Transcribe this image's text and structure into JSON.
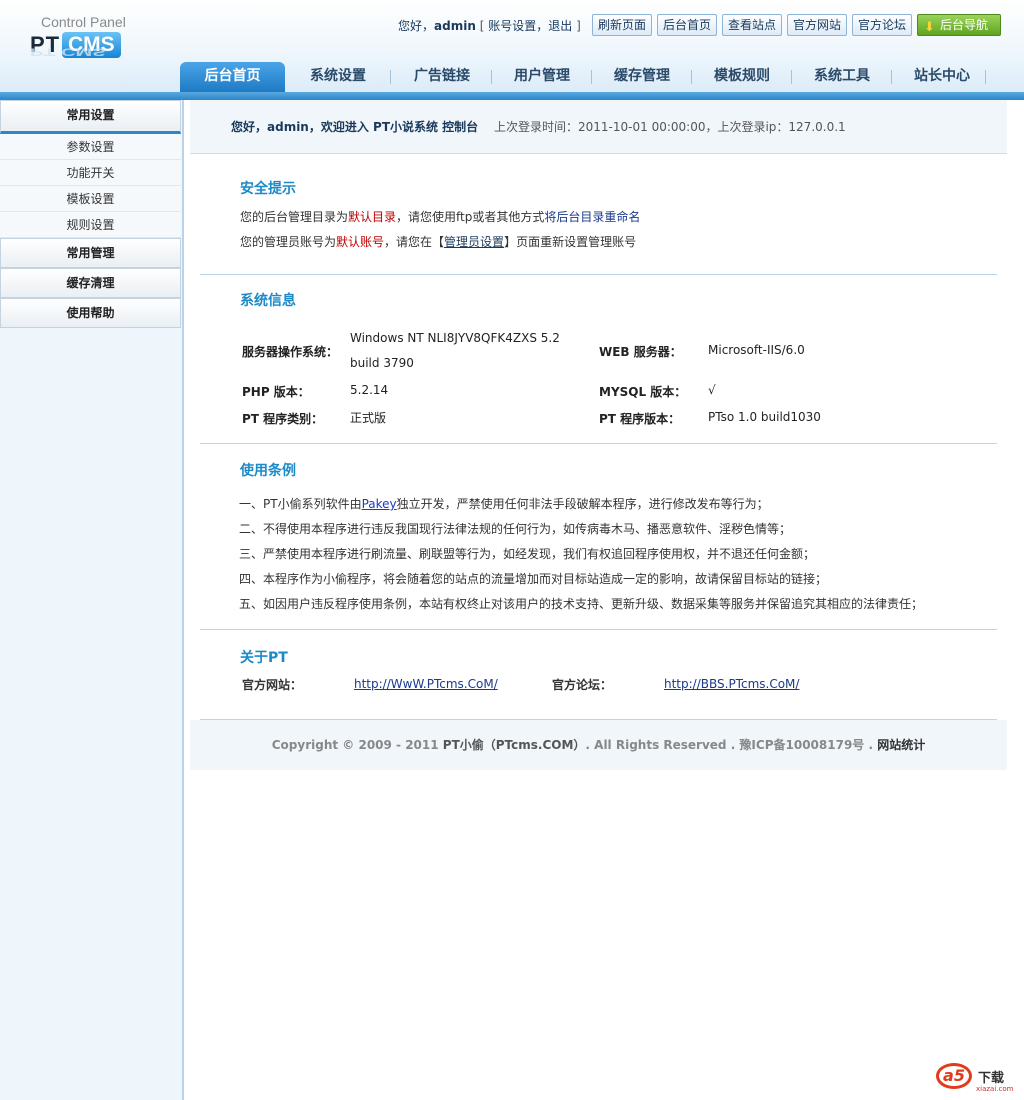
{
  "header": {
    "logo_top": "Control Panel",
    "logo_pt": "PT",
    "logo_cms": "CMS",
    "greeting": "您好，",
    "username": "admin",
    "bracket_open": "[",
    "account_settings": "账号设置",
    "comma": "，",
    "logout": "退出",
    "bracket_close": "]",
    "buttons": [
      "刷新页面",
      "后台首页",
      "查看站点",
      "官方网站",
      "官方论坛",
      "后台导航"
    ],
    "nav": [
      "后台首页",
      "系统设置",
      "广告链接",
      "用户管理",
      "缓存管理",
      "模板规则",
      "系统工具",
      "站长中心"
    ],
    "active_nav": "后台首页",
    "accent": "#1e7ac4"
  },
  "sidebar": {
    "sections": [
      {
        "title": "常用设置",
        "items": [
          "参数设置",
          "功能开关",
          "模板设置",
          "规则设置"
        ]
      },
      {
        "title": "常用管理",
        "items": []
      },
      {
        "title": "缓存清理",
        "items": []
      },
      {
        "title": "使用帮助",
        "items": []
      }
    ]
  },
  "welcome": {
    "text": "您好，admin，欢迎进入 PT小说系统 控制台",
    "lastlogin": "上次登录时间：2011-10-01 00:00:00，上次登录ip：127.0.0.1"
  },
  "security": {
    "title": "安全提示",
    "line1_a": "您的后台管理目录为",
    "line1_red": "默认目录",
    "line1_b": "，请您使用ftp或者其他方式",
    "line1_navy": "将后台目录重命名",
    "line2_a": "您的管理员账号为",
    "line2_red": "默认账号",
    "line2_b": "，请您在【",
    "line2_link": "管理员设置",
    "line2_c": "】页面重新设置管理账号"
  },
  "sysinfo": {
    "title": "系统信息",
    "os_label": "服务器操作系统：",
    "os_value_1": "Windows NT NLI8JYV8QFK4ZXS 5.2",
    "os_value_2": "build 3790",
    "web_label": "WEB 服务器：",
    "web_value": "Microsoft-IIS/6.0",
    "php_label": "PHP 版本：",
    "php_value": "5.2.14",
    "mysql_label": "MYSQL 版本：",
    "mysql_value": "√",
    "type_label": "PT 程序类别：",
    "type_value": "正式版",
    "ver_label": "PT 程序版本：",
    "ver_value": "PTso 1.0 build1030"
  },
  "terms": {
    "title": "使用条例",
    "item1_a": "一、PT小偷系列软件由",
    "item1_link": "Pakey",
    "item1_b": "独立开发，严禁使用任何非法手段破解本程序，进行修改发布等行为；",
    "items": [
      "二、不得使用本程序进行违反我国现行法律法规的任何行为，如传病毒木马、播恶意软件、淫秽色情等；",
      "三、严禁使用本程序进行刷流量、刷联盟等行为，如经发现，我们有权追回程序使用权，并不退还任何金额；",
      "四、本程序作为小偷程序，将会随着您的站点的流量增加而对目标站造成一定的影响，故请保留目标站的链接；",
      "五、如因用户违反程序使用条例，本站有权终止对该用户的技术支持、更新升级、数据采集等服务并保留追究其相应的法律责任；"
    ]
  },
  "about": {
    "title": "关于PT",
    "site_label": "官方网站：",
    "site_url": "http://WwW.PTcms.CoM/",
    "bbs_label": "官方论坛：",
    "bbs_url": "http://BBS.PTcms.CoM/"
  },
  "footer": {
    "copyright": "Copyright © 2009 - 2011 ",
    "brand": "PT小偷（PTcms.COM）",
    "rights": ". All Rights Reserved . 豫ICP备10008179号  . ",
    "stat": "网站统计"
  },
  "watermark": {
    "logo": "a5",
    "label": "下载",
    "site": "xiazai.com"
  }
}
